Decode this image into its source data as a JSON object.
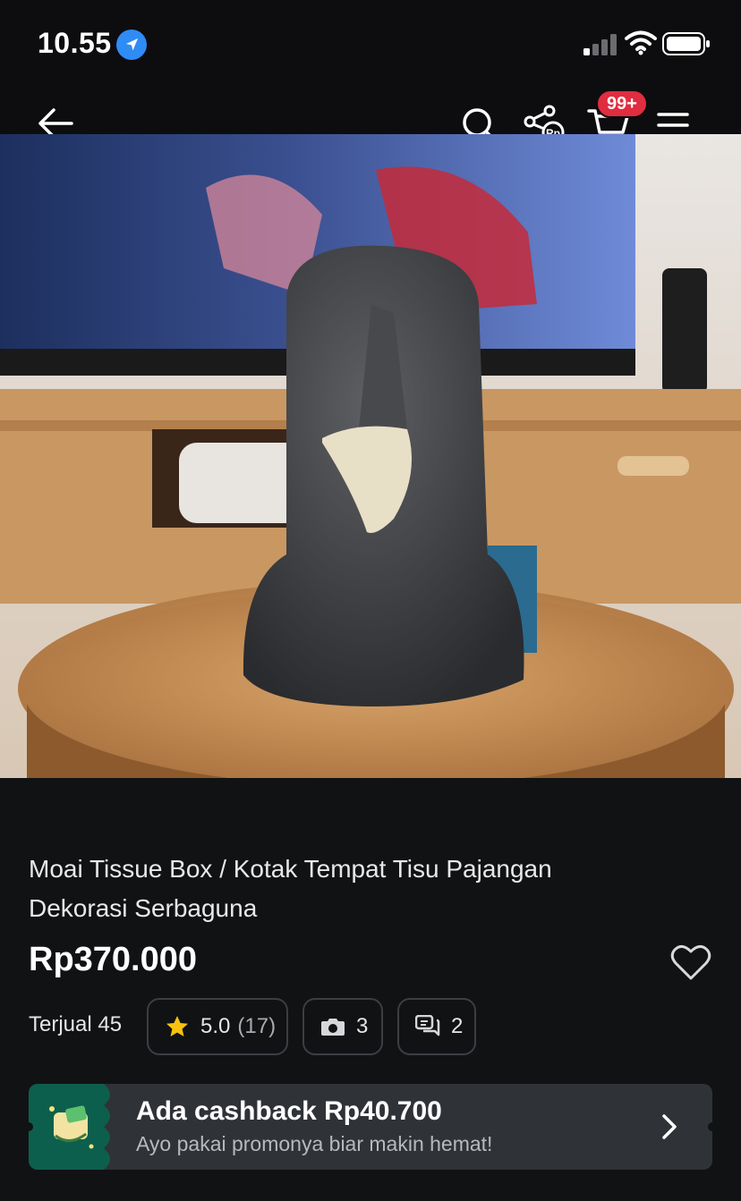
{
  "status_bar": {
    "time": "10.55",
    "location_icon": "location-arrow-icon",
    "signal_icon": "cellular-signal-icon",
    "wifi_icon": "wifi-icon",
    "battery_icon": "battery-icon"
  },
  "nav": {
    "back_icon": "arrow-left-icon",
    "search_icon": "search-icon",
    "share_icon": "share-rp-icon",
    "cart_icon": "cart-icon",
    "cart_badge": "99+",
    "menu_icon": "hamburger-menu-icon"
  },
  "product": {
    "image_icon": "moai-tissue-box-photo",
    "title": "Moai Tissue Box / Kotak Tempat Tisu Pajangan Dekorasi Serbaguna",
    "price": "Rp370.000",
    "sold": "Terjual 45",
    "rating": "5.0",
    "rating_count": "(17)",
    "photos_count": "3",
    "discussion_count": "2"
  },
  "cashback": {
    "title": "Ada cashback Rp40.700",
    "subtitle": "Ayo pakai promonya biar makin hemat!"
  },
  "colors": {
    "background": "#111214",
    "badge": "#e02d3f",
    "star": "#f7c20f",
    "cashback_accent": "#0d5f4d"
  }
}
